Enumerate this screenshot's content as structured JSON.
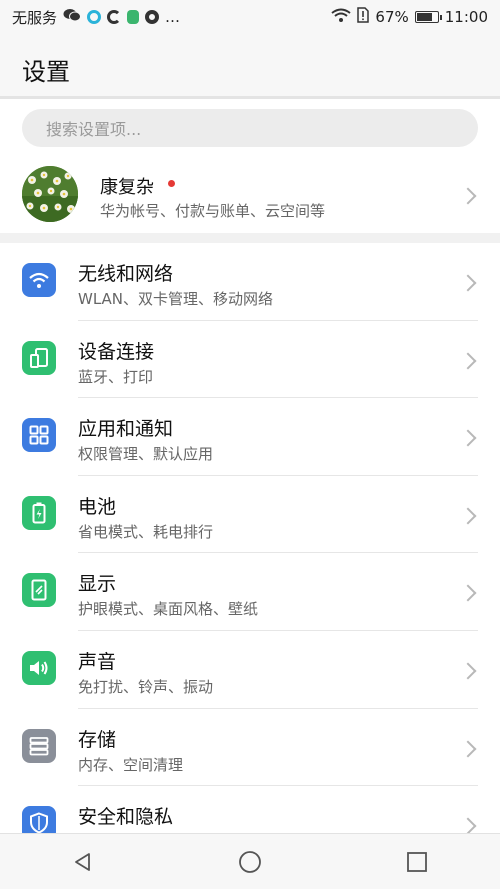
{
  "status_bar": {
    "carrier": "无服务",
    "more": "…",
    "battery_percent": "67%",
    "battery_level": 0.67,
    "time": "11:00"
  },
  "header": {
    "title": "设置"
  },
  "search": {
    "placeholder": "搜索设置项..."
  },
  "account": {
    "name": "康复杂",
    "subtitle": "华为帐号、付款与账单、云空间等"
  },
  "items": [
    {
      "title": "无线和网络",
      "subtitle": "WLAN、双卡管理、移动网络",
      "icon": "wifi-icon",
      "color": "#3d7be0"
    },
    {
      "title": "设备连接",
      "subtitle": "蓝牙、打印",
      "icon": "device-connect-icon",
      "color": "#2fbf71"
    },
    {
      "title": "应用和通知",
      "subtitle": "权限管理、默认应用",
      "icon": "apps-icon",
      "color": "#3d7be0"
    },
    {
      "title": "电池",
      "subtitle": "省电模式、耗电排行",
      "icon": "battery-icon",
      "color": "#2fbf71"
    },
    {
      "title": "显示",
      "subtitle": "护眼模式、桌面风格、壁纸",
      "icon": "display-icon",
      "color": "#2fbf71"
    },
    {
      "title": "声音",
      "subtitle": "免打扰、铃声、振动",
      "icon": "sound-icon",
      "color": "#2fbf71"
    },
    {
      "title": "存储",
      "subtitle": "内存、空间清理",
      "icon": "storage-icon",
      "color": "#8a8f99"
    },
    {
      "title": "安全和隐私",
      "subtitle": "",
      "icon": "shield-icon",
      "color": "#3d7be0"
    }
  ]
}
